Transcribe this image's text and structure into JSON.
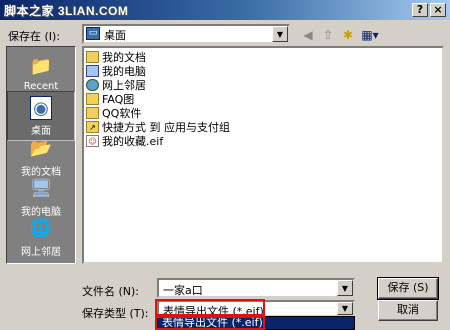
{
  "titlebar": {
    "title": "脚本之家 3LIAN.COM",
    "help": "?",
    "close": "×"
  },
  "save_in": {
    "label": "保存在 (I):",
    "value": "桌面"
  },
  "places": [
    {
      "label": "Recent",
      "icon": "folder-clock-icon"
    },
    {
      "label": "桌面",
      "icon": "desktop-icon"
    },
    {
      "label": "我的文档",
      "icon": "documents-icon"
    },
    {
      "label": "我的电脑",
      "icon": "computer-icon"
    },
    {
      "label": "网上邻居",
      "icon": "network-icon"
    }
  ],
  "files": [
    {
      "name": "我的文档",
      "icon": "documents-folder-icon"
    },
    {
      "name": "我的电脑",
      "icon": "computer-icon"
    },
    {
      "name": "网上邻居",
      "icon": "network-icon"
    },
    {
      "name": "FAQ图",
      "icon": "folder-icon"
    },
    {
      "name": "QQ软件",
      "icon": "folder-icon"
    },
    {
      "name": "快捷方式 到 应用与支付组",
      "icon": "shortcut-folder-icon"
    },
    {
      "name": "我的收藏.eif",
      "icon": "eif-file-icon"
    }
  ],
  "filename": {
    "label": "文件名 (N):",
    "value": "一家a口"
  },
  "filetype": {
    "label": "保存类型 (T):",
    "value": "表情导出文件 (*.eif)",
    "option_selected": "表情导出文件 (*.eif)"
  },
  "buttons": {
    "save": "保存 (S)",
    "cancel": "取消"
  },
  "colors": {
    "title_start": "#0a246a",
    "highlight": "#0a246a",
    "annotation": "#e01010"
  }
}
